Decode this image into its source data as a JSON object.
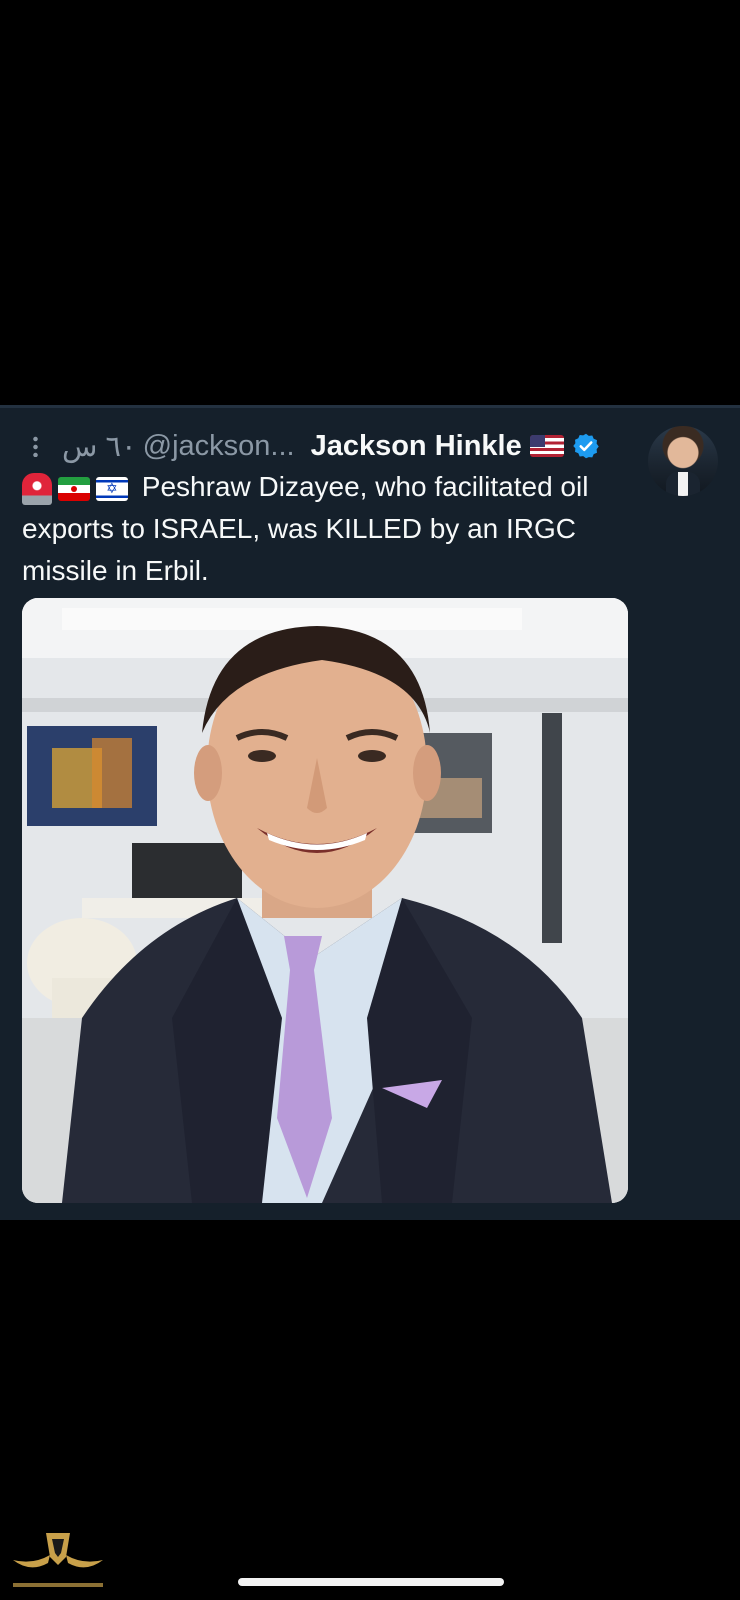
{
  "tweet": {
    "display_name": "Jackson Hinkle",
    "handle": "@jackson...",
    "time_ago": "٦٠ س",
    "verified": true,
    "text": "Peshraw Dizayee, who facilitated oil exports to ISRAEL, was KILLED by an IRGC missile in Erbil.",
    "emoji_icons": [
      "siren-icon",
      "iran-flag-icon",
      "israel-flag-icon"
    ],
    "name_flag": "us-flag-icon",
    "more_icon": "more-vertical-icon"
  },
  "colors": {
    "background": "#000000",
    "card": "#15202b",
    "text_primary": "#f7f9f9",
    "text_secondary": "#8b98a5",
    "verified_blue": "#1d9bf0"
  }
}
